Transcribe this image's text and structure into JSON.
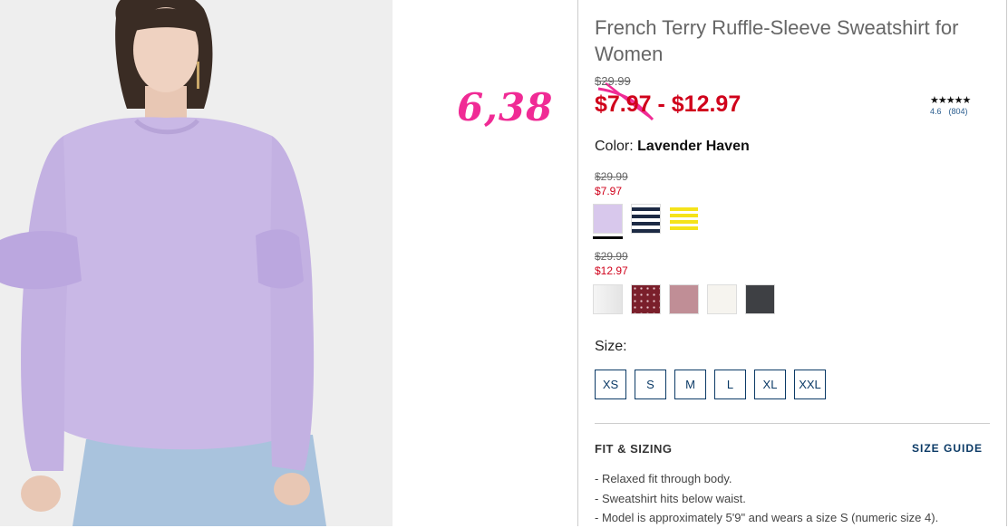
{
  "product": {
    "title": "French Terry Ruffle-Sleeve Sweatshirt for Women",
    "original_price": "$29.99",
    "sale_price_range": "$7.97 - $12.97",
    "rating_stars": "★★★★★",
    "rating_value": "4.6",
    "review_count": "(804)",
    "color_label": "Color:",
    "color_name": "Lavender Haven"
  },
  "annotation": {
    "handwritten_price": "6,38"
  },
  "tiers": [
    {
      "was": "$29.99",
      "now": "$7.97",
      "swatches": [
        {
          "name": "Lavender",
          "color": "#d8c8ec",
          "selected": true
        },
        {
          "name": "Navy Stripe",
          "color": "#1c2a44",
          "pattern": "stripes-navy"
        },
        {
          "name": "Yellow Stripe",
          "color": "#f5e31a",
          "pattern": "stripes-yellow"
        }
      ]
    },
    {
      "was": "$29.99",
      "now": "$12.97",
      "swatches": [
        {
          "name": "Light Grey",
          "color": "#eeeeee"
        },
        {
          "name": "Burgundy Dot",
          "color": "#7a1f2b",
          "pattern": "dots"
        },
        {
          "name": "Dusty Rose",
          "color": "#c08e96"
        },
        {
          "name": "Cream",
          "color": "#f6f4ef"
        },
        {
          "name": "Charcoal",
          "color": "#3e4044"
        }
      ]
    }
  ],
  "size": {
    "label": "Size:",
    "options": [
      "XS",
      "S",
      "M",
      "L",
      "XL",
      "XXL"
    ]
  },
  "fit": {
    "title": "FIT & SIZING",
    "size_guide": "SIZE GUIDE",
    "bullets": [
      "-  Relaxed fit through body.",
      "-  Sweatshirt hits below waist.",
      "-  Model is approximately 5'9\" and wears a size S (numeric size 4)."
    ]
  },
  "colors": {
    "sale_red": "#d0021b",
    "link_navy": "#0b3a66",
    "annotation_pink": "#f02b95"
  }
}
